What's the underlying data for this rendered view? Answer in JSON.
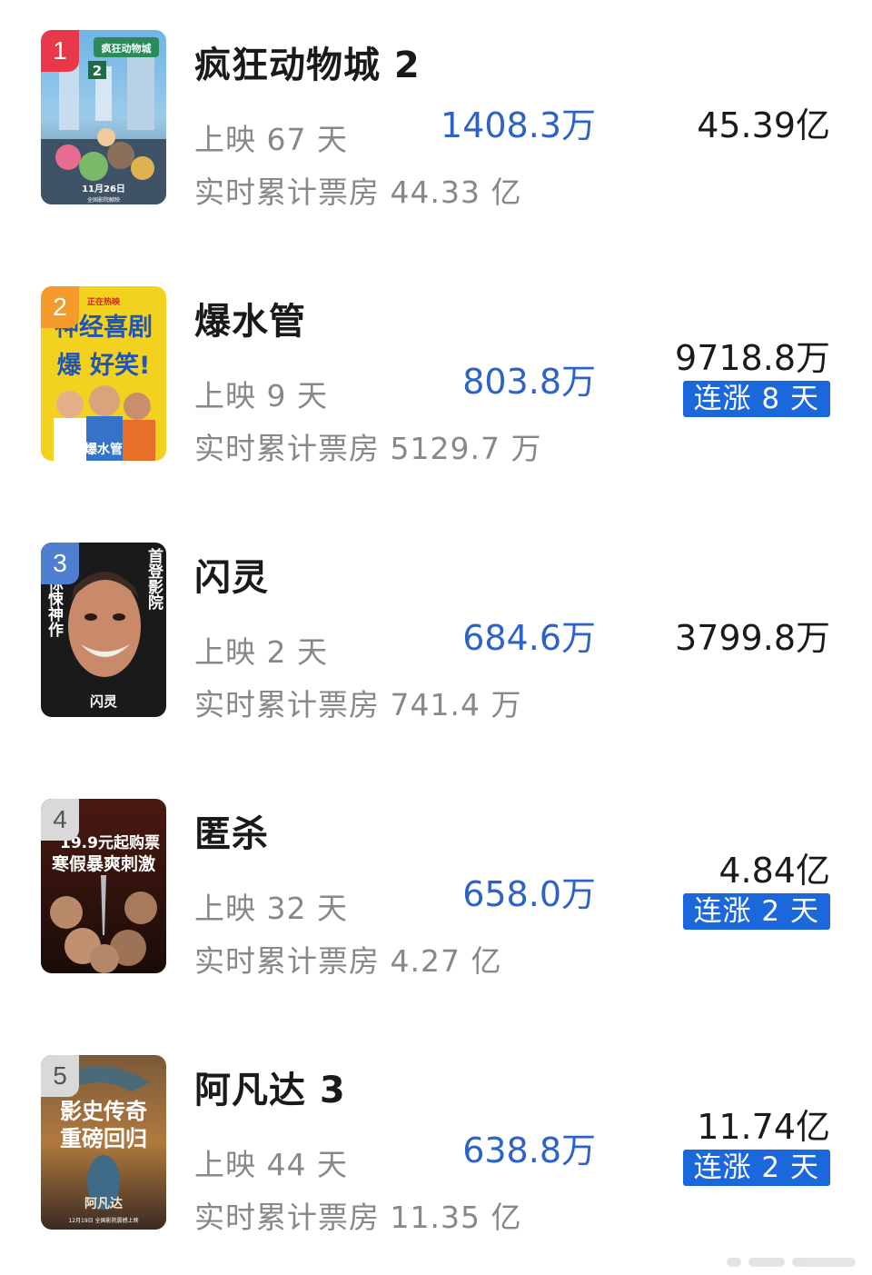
{
  "movies": [
    {
      "rank": "1",
      "title": "疯狂动物城 2",
      "days": "上映 67 天",
      "cumulative": "实时累计票房 44.33 亿",
      "today": "1408.3万",
      "total": "45.39亿",
      "streak": ""
    },
    {
      "rank": "2",
      "title": "爆水管",
      "days": "上映 9 天",
      "cumulative": "实时累计票房 5129.7 万",
      "today": "803.8万",
      "total": "9718.8万",
      "streak": "连涨 8 天"
    },
    {
      "rank": "3",
      "title": "闪灵",
      "days": "上映 2 天",
      "cumulative": "实时累计票房 741.4 万",
      "today": "684.6万",
      "total": "3799.8万",
      "streak": ""
    },
    {
      "rank": "4",
      "title": "匿杀",
      "days": "上映 32 天",
      "cumulative": "实时累计票房 4.27 亿",
      "today": "658.0万",
      "total": "4.84亿",
      "streak": "连涨 2 天"
    },
    {
      "rank": "5",
      "title": "阿凡达 3",
      "days": "上映 44 天",
      "cumulative": "实时累计票房 11.35 亿",
      "today": "638.8万",
      "total": "11.74亿",
      "streak": "连涨 2 天"
    }
  ],
  "posters": {
    "p1": {
      "logo": "疯狂动物城",
      "num": "2",
      "date": "11月26日",
      "sub": "全国影院献映"
    },
    "p2": {
      "tag": "正在热映",
      "line1": "神经喜剧",
      "line2": "爆 好笑!",
      "logo": "爆水管"
    },
    "p3": {
      "left": "惊悚神作",
      "right": "首登影院",
      "logo": "闪灵"
    },
    "p4": {
      "line1": "19.9元起购票",
      "line2": "寒假暴爽刺激"
    },
    "p5": {
      "line1": "影史传奇",
      "line2": "重磅回归",
      "logo": "阿凡达",
      "date": "12月19日 全国影院震撼上映"
    }
  },
  "colors": {
    "accent_blue": "#2d63c8",
    "badge_blue": "#1a68dc",
    "rank1": "#e8394a",
    "rank2": "#f59a2c",
    "rank3": "#4f7fd0",
    "rank_other": "#d9d9d9"
  }
}
